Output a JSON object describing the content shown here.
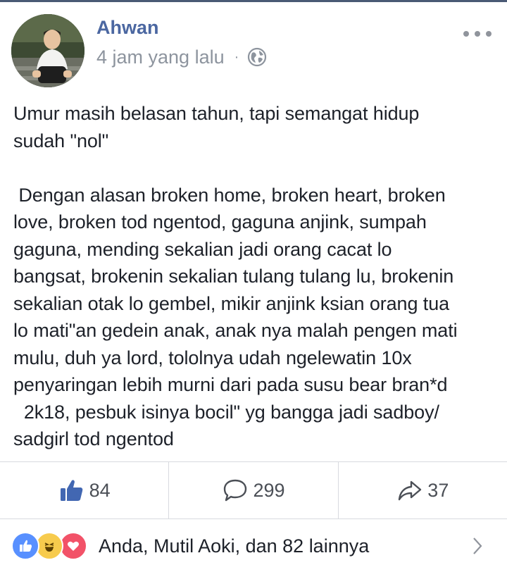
{
  "post": {
    "author": "Ahwan",
    "time": "4 jam yang lalu",
    "separator": "·",
    "privacy_icon": "globe-icon",
    "more_icon": "more-options-icon",
    "text": "Umur masih belasan tahun, tapi semangat hidup\nsudah \"nol\"\n\n Dengan alasan broken home, broken heart, broken\nlove, broken tod ngentod, gaguna anjink, sumpah\ngaguna, mending sekalian jadi orang cacat lo\nbangsat, brokenin sekalian tulang tulang lu, brokenin\nsekalian otak lo gembel, mikir anjink ksian orang tua\nlo mati\"an gedein anak, anak nya malah pengen mati\nmulu, duh ya lord, tololnya udah ngelewatin 10x\npenyaringan lebih murni dari pada susu bear bran*d\n  2k18, pesbuk isinya bocil\" yg bangga jadi sadboy/\nsadgirl tod ngentod"
  },
  "actions": {
    "likes": "84",
    "comments": "299",
    "shares": "37",
    "like_color": "#4267b2"
  },
  "reactions": {
    "summary": "Anda, Mutil Aoki, dan 82 lainnya",
    "icons": [
      "like-reaction-icon",
      "haha-reaction-icon",
      "love-reaction-icon"
    ]
  },
  "colors": {
    "author": "#4b67a1",
    "meta": "#8d949e",
    "text": "#1d2129",
    "divider": "#d8dadf"
  }
}
